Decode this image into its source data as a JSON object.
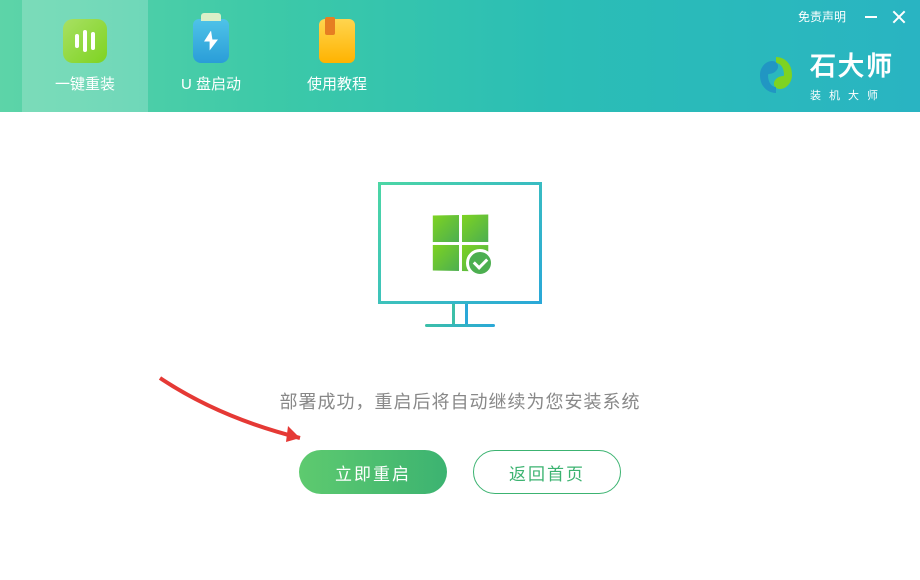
{
  "header": {
    "disclaimer": "免责声明",
    "tabs": [
      {
        "label": "一键重装",
        "icon": "reinstall-icon",
        "active": true
      },
      {
        "label": "U 盘启动",
        "icon": "usb-icon",
        "active": false
      },
      {
        "label": "使用教程",
        "icon": "tutorial-icon",
        "active": false
      }
    ],
    "brand": {
      "name": "石大师",
      "sub": "装机大师"
    }
  },
  "main": {
    "status": "部署成功，重启后将自动继续为您安装系统",
    "primary_btn": "立即重启",
    "secondary_btn": "返回首页"
  }
}
